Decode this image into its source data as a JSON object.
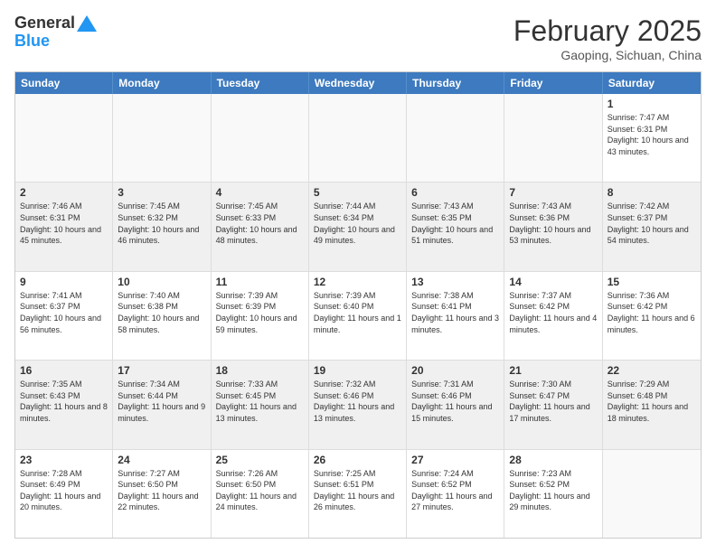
{
  "header": {
    "logo_line1": "General",
    "logo_line2": "Blue",
    "month_title": "February 2025",
    "location": "Gaoping, Sichuan, China"
  },
  "days_of_week": [
    "Sunday",
    "Monday",
    "Tuesday",
    "Wednesday",
    "Thursday",
    "Friday",
    "Saturday"
  ],
  "weeks": [
    [
      {
        "day": "",
        "info": ""
      },
      {
        "day": "",
        "info": ""
      },
      {
        "day": "",
        "info": ""
      },
      {
        "day": "",
        "info": ""
      },
      {
        "day": "",
        "info": ""
      },
      {
        "day": "",
        "info": ""
      },
      {
        "day": "1",
        "info": "Sunrise: 7:47 AM\nSunset: 6:31 PM\nDaylight: 10 hours\nand 43 minutes."
      }
    ],
    [
      {
        "day": "2",
        "info": "Sunrise: 7:46 AM\nSunset: 6:31 PM\nDaylight: 10 hours\nand 45 minutes."
      },
      {
        "day": "3",
        "info": "Sunrise: 7:45 AM\nSunset: 6:32 PM\nDaylight: 10 hours\nand 46 minutes."
      },
      {
        "day": "4",
        "info": "Sunrise: 7:45 AM\nSunset: 6:33 PM\nDaylight: 10 hours\nand 48 minutes."
      },
      {
        "day": "5",
        "info": "Sunrise: 7:44 AM\nSunset: 6:34 PM\nDaylight: 10 hours\nand 49 minutes."
      },
      {
        "day": "6",
        "info": "Sunrise: 7:43 AM\nSunset: 6:35 PM\nDaylight: 10 hours\nand 51 minutes."
      },
      {
        "day": "7",
        "info": "Sunrise: 7:43 AM\nSunset: 6:36 PM\nDaylight: 10 hours\nand 53 minutes."
      },
      {
        "day": "8",
        "info": "Sunrise: 7:42 AM\nSunset: 6:37 PM\nDaylight: 10 hours\nand 54 minutes."
      }
    ],
    [
      {
        "day": "9",
        "info": "Sunrise: 7:41 AM\nSunset: 6:37 PM\nDaylight: 10 hours\nand 56 minutes."
      },
      {
        "day": "10",
        "info": "Sunrise: 7:40 AM\nSunset: 6:38 PM\nDaylight: 10 hours\nand 58 minutes."
      },
      {
        "day": "11",
        "info": "Sunrise: 7:39 AM\nSunset: 6:39 PM\nDaylight: 10 hours\nand 59 minutes."
      },
      {
        "day": "12",
        "info": "Sunrise: 7:39 AM\nSunset: 6:40 PM\nDaylight: 11 hours\nand 1 minute."
      },
      {
        "day": "13",
        "info": "Sunrise: 7:38 AM\nSunset: 6:41 PM\nDaylight: 11 hours\nand 3 minutes."
      },
      {
        "day": "14",
        "info": "Sunrise: 7:37 AM\nSunset: 6:42 PM\nDaylight: 11 hours\nand 4 minutes."
      },
      {
        "day": "15",
        "info": "Sunrise: 7:36 AM\nSunset: 6:42 PM\nDaylight: 11 hours\nand 6 minutes."
      }
    ],
    [
      {
        "day": "16",
        "info": "Sunrise: 7:35 AM\nSunset: 6:43 PM\nDaylight: 11 hours\nand 8 minutes."
      },
      {
        "day": "17",
        "info": "Sunrise: 7:34 AM\nSunset: 6:44 PM\nDaylight: 11 hours\nand 9 minutes."
      },
      {
        "day": "18",
        "info": "Sunrise: 7:33 AM\nSunset: 6:45 PM\nDaylight: 11 hours\nand 13 minutes."
      },
      {
        "day": "19",
        "info": "Sunrise: 7:32 AM\nSunset: 6:46 PM\nDaylight: 11 hours\nand 13 minutes."
      },
      {
        "day": "20",
        "info": "Sunrise: 7:31 AM\nSunset: 6:46 PM\nDaylight: 11 hours\nand 15 minutes."
      },
      {
        "day": "21",
        "info": "Sunrise: 7:30 AM\nSunset: 6:47 PM\nDaylight: 11 hours\nand 17 minutes."
      },
      {
        "day": "22",
        "info": "Sunrise: 7:29 AM\nSunset: 6:48 PM\nDaylight: 11 hours\nand 18 minutes."
      }
    ],
    [
      {
        "day": "23",
        "info": "Sunrise: 7:28 AM\nSunset: 6:49 PM\nDaylight: 11 hours\nand 20 minutes."
      },
      {
        "day": "24",
        "info": "Sunrise: 7:27 AM\nSunset: 6:50 PM\nDaylight: 11 hours\nand 22 minutes."
      },
      {
        "day": "25",
        "info": "Sunrise: 7:26 AM\nSunset: 6:50 PM\nDaylight: 11 hours\nand 24 minutes."
      },
      {
        "day": "26",
        "info": "Sunrise: 7:25 AM\nSunset: 6:51 PM\nDaylight: 11 hours\nand 26 minutes."
      },
      {
        "day": "27",
        "info": "Sunrise: 7:24 AM\nSunset: 6:52 PM\nDaylight: 11 hours\nand 27 minutes."
      },
      {
        "day": "28",
        "info": "Sunrise: 7:23 AM\nSunset: 6:52 PM\nDaylight: 11 hours\nand 29 minutes."
      },
      {
        "day": "",
        "info": ""
      }
    ]
  ]
}
